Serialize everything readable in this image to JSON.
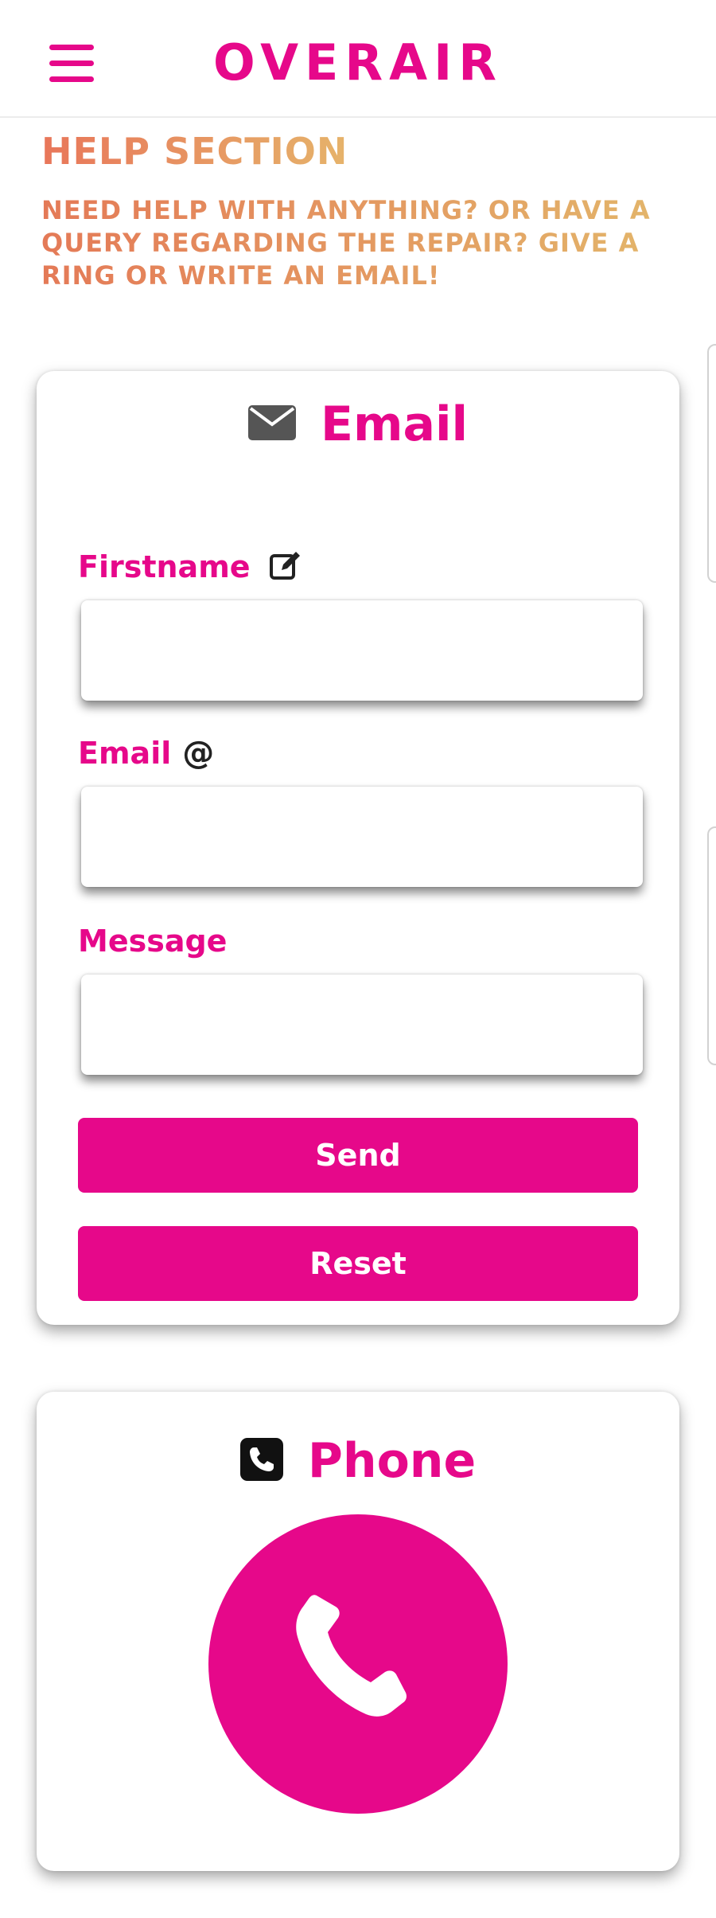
{
  "header": {
    "brand": "OVERAIR",
    "menu_icon": "hamburger-menu-icon"
  },
  "help": {
    "title": "HELP SECTION",
    "text": "NEED HELP WITH ANYTHING? OR HAVE A QUERY REGARDING THE REPAIR? GIVE A RING OR WRITE AN EMAIL!"
  },
  "email_card": {
    "title": "Email",
    "icon": "envelope-icon",
    "fields": {
      "firstname": {
        "label": "Firstname",
        "icon": "edit-icon",
        "value": "",
        "placeholder": ""
      },
      "email": {
        "label": "Email",
        "icon_text": "@",
        "value": "",
        "placeholder": ""
      },
      "message": {
        "label": "Message",
        "value": "",
        "placeholder": ""
      }
    },
    "send_label": "Send",
    "reset_label": "Reset"
  },
  "phone_card": {
    "title": "Phone",
    "icon": "phone-square-icon",
    "call_icon": "phone-icon"
  },
  "colors": {
    "brand": "#e6088a",
    "heading_gradient_start": "#e8765a",
    "heading_gradient_end": "#e6b36a"
  }
}
